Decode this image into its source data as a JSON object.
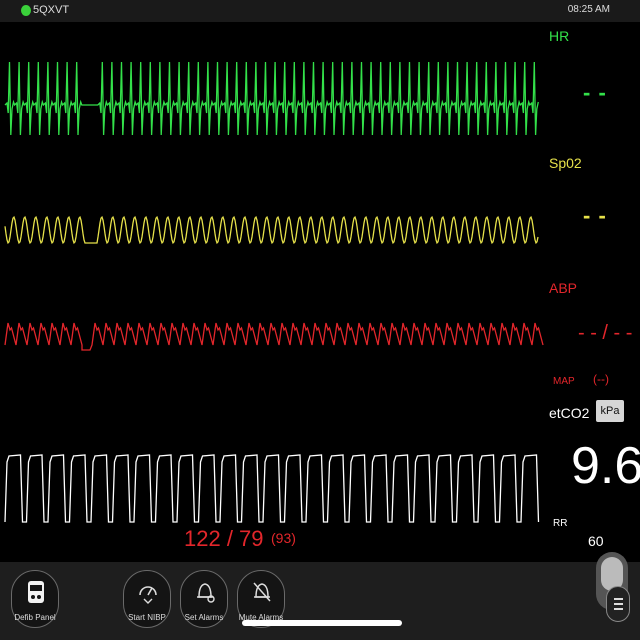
{
  "status": {
    "device_name": "5QXVT",
    "time": "08:25 AM"
  },
  "colors": {
    "hr": "#33e14a",
    "spo2": "#e6e14a",
    "abp": "#e3262b",
    "co2": "#ffffff"
  },
  "vitals": {
    "hr": {
      "label": "HR",
      "value": "- -"
    },
    "spo2": {
      "label": "Sp02",
      "value": "- -"
    },
    "abp": {
      "label": "ABP",
      "value": "- - / - -",
      "map_label": "MAP",
      "map_value": "(--)"
    },
    "etco2": {
      "label": "etCO2",
      "unit": "kPa",
      "value": "9.6",
      "rr_label": "RR",
      "rr_value": "60"
    }
  },
  "nibp": {
    "reading": "122 / 79",
    "mean": "(93)"
  },
  "buttons": [
    {
      "label": "Defib Panel",
      "icon": "defib-icon"
    },
    {
      "label": "Start NIBP",
      "icon": "nibp-gauge-icon"
    },
    {
      "label": "Set Alarms",
      "icon": "bell-settings-icon"
    },
    {
      "label": "Mute Alarms",
      "icon": "bell-muted-icon"
    }
  ]
}
